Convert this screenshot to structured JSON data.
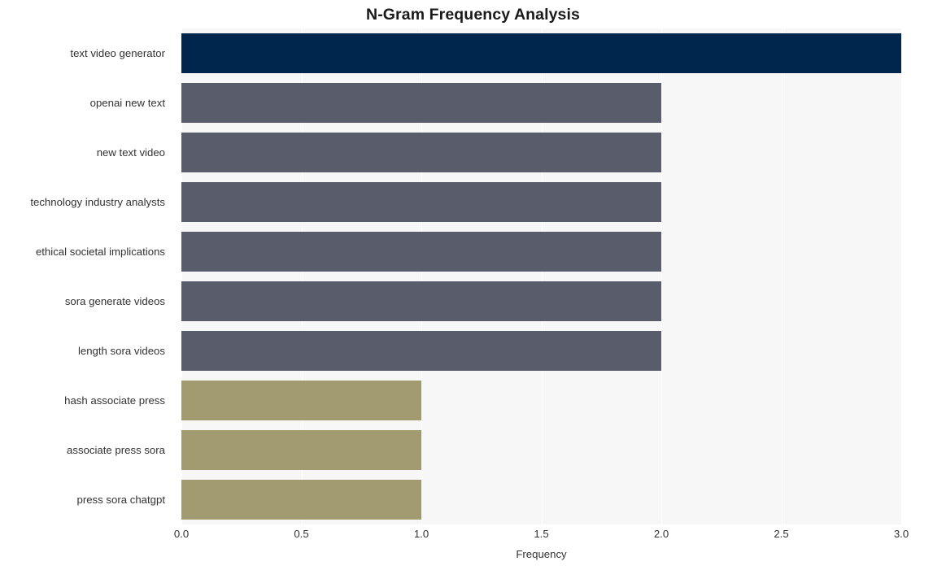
{
  "chart_data": {
    "type": "bar",
    "orientation": "horizontal",
    "title": "N-Gram Frequency Analysis",
    "xlabel": "Frequency",
    "ylabel": "",
    "xlim": [
      0.0,
      3.0
    ],
    "xticks": [
      "0.0",
      "0.5",
      "1.0",
      "1.5",
      "2.0",
      "2.5",
      "3.0"
    ],
    "xtick_values": [
      0.0,
      0.5,
      1.0,
      1.5,
      2.0,
      2.5,
      3.0
    ],
    "grid": true,
    "grid_axis": "x",
    "legend": "none",
    "categories": [
      "text video generator",
      "openai new text",
      "new text video",
      "technology industry analysts",
      "ethical societal implications",
      "sora generate videos",
      "length sora videos",
      "hash associate press",
      "associate press sora",
      "press sora chatgpt"
    ],
    "values": [
      3,
      2,
      2,
      2,
      2,
      2,
      2,
      1,
      1,
      1
    ],
    "bar_colors": [
      "#00264d",
      "#585c6b",
      "#585c6b",
      "#585c6b",
      "#585c6b",
      "#585c6b",
      "#585c6b",
      "#a39b70",
      "#a39b70",
      "#a39b70"
    ]
  },
  "style": {
    "figure_background": "#ffffff",
    "plot_background": "#f7f7f8",
    "grid_color": "#ffffff",
    "text_color": "#323232",
    "title_color": "#1a1a1a"
  }
}
